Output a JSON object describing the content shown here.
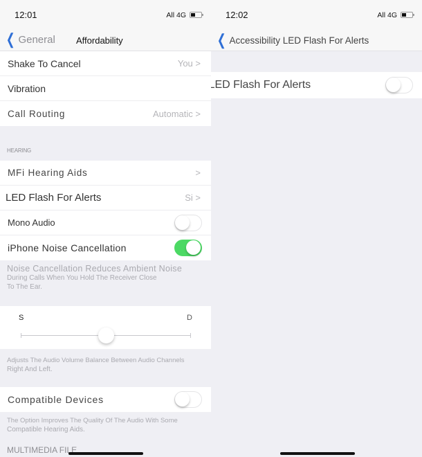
{
  "left": {
    "status": {
      "time": "12:01",
      "carrier": "All 4G",
      "battery_icon": "battery-low-icon"
    },
    "nav": {
      "back_label": "General",
      "title": "Affordability"
    },
    "top_group": [
      {
        "label": "Shake To Cancel",
        "value": "You >"
      },
      {
        "label": "Vibration",
        "value": ""
      },
      {
        "label": "Call Routing",
        "value": "Automatic >"
      }
    ],
    "hearing_header": "HEARING",
    "hearing_group": [
      {
        "label": "MFi Hearing Aids",
        "value": ">"
      },
      {
        "label": "LED Flash For Alerts",
        "value": "Si >"
      },
      {
        "label": "Mono Audio",
        "toggle": false
      },
      {
        "label": "iPhone Noise Cancellation",
        "toggle": true
      }
    ],
    "noise_footer": [
      "Noise Cancellation Reduces Ambient Noise",
      "During Calls When You Hold The Receiver Close",
      "To The Ear."
    ],
    "balance": {
      "left_label": "S",
      "right_label": "D",
      "value_fraction": 0.5
    },
    "balance_footer": [
      "Adjusts The Audio Volume Balance Between Audio Channels",
      "Right And Left."
    ],
    "compatible": {
      "label": "Compatible Devices",
      "toggle": false
    },
    "compatible_footer": [
      "The Option Improves The Quality Of The Audio With Some",
      "Compatible Hearing Aids."
    ],
    "multimedia_title": "MULTIMEDIA FILE"
  },
  "right": {
    "status": {
      "time": "12:02",
      "carrier": "All 4G",
      "battery_icon": "battery-low-icon"
    },
    "nav": {
      "back_label": "Accessibility LED Flash For Alerts"
    },
    "row": {
      "label": "Yes LED Flash For Alerts",
      "toggle": false
    }
  },
  "colors": {
    "accent": "#2f6fd6",
    "toggle_on": "#4cd964",
    "background": "#efeff4"
  }
}
